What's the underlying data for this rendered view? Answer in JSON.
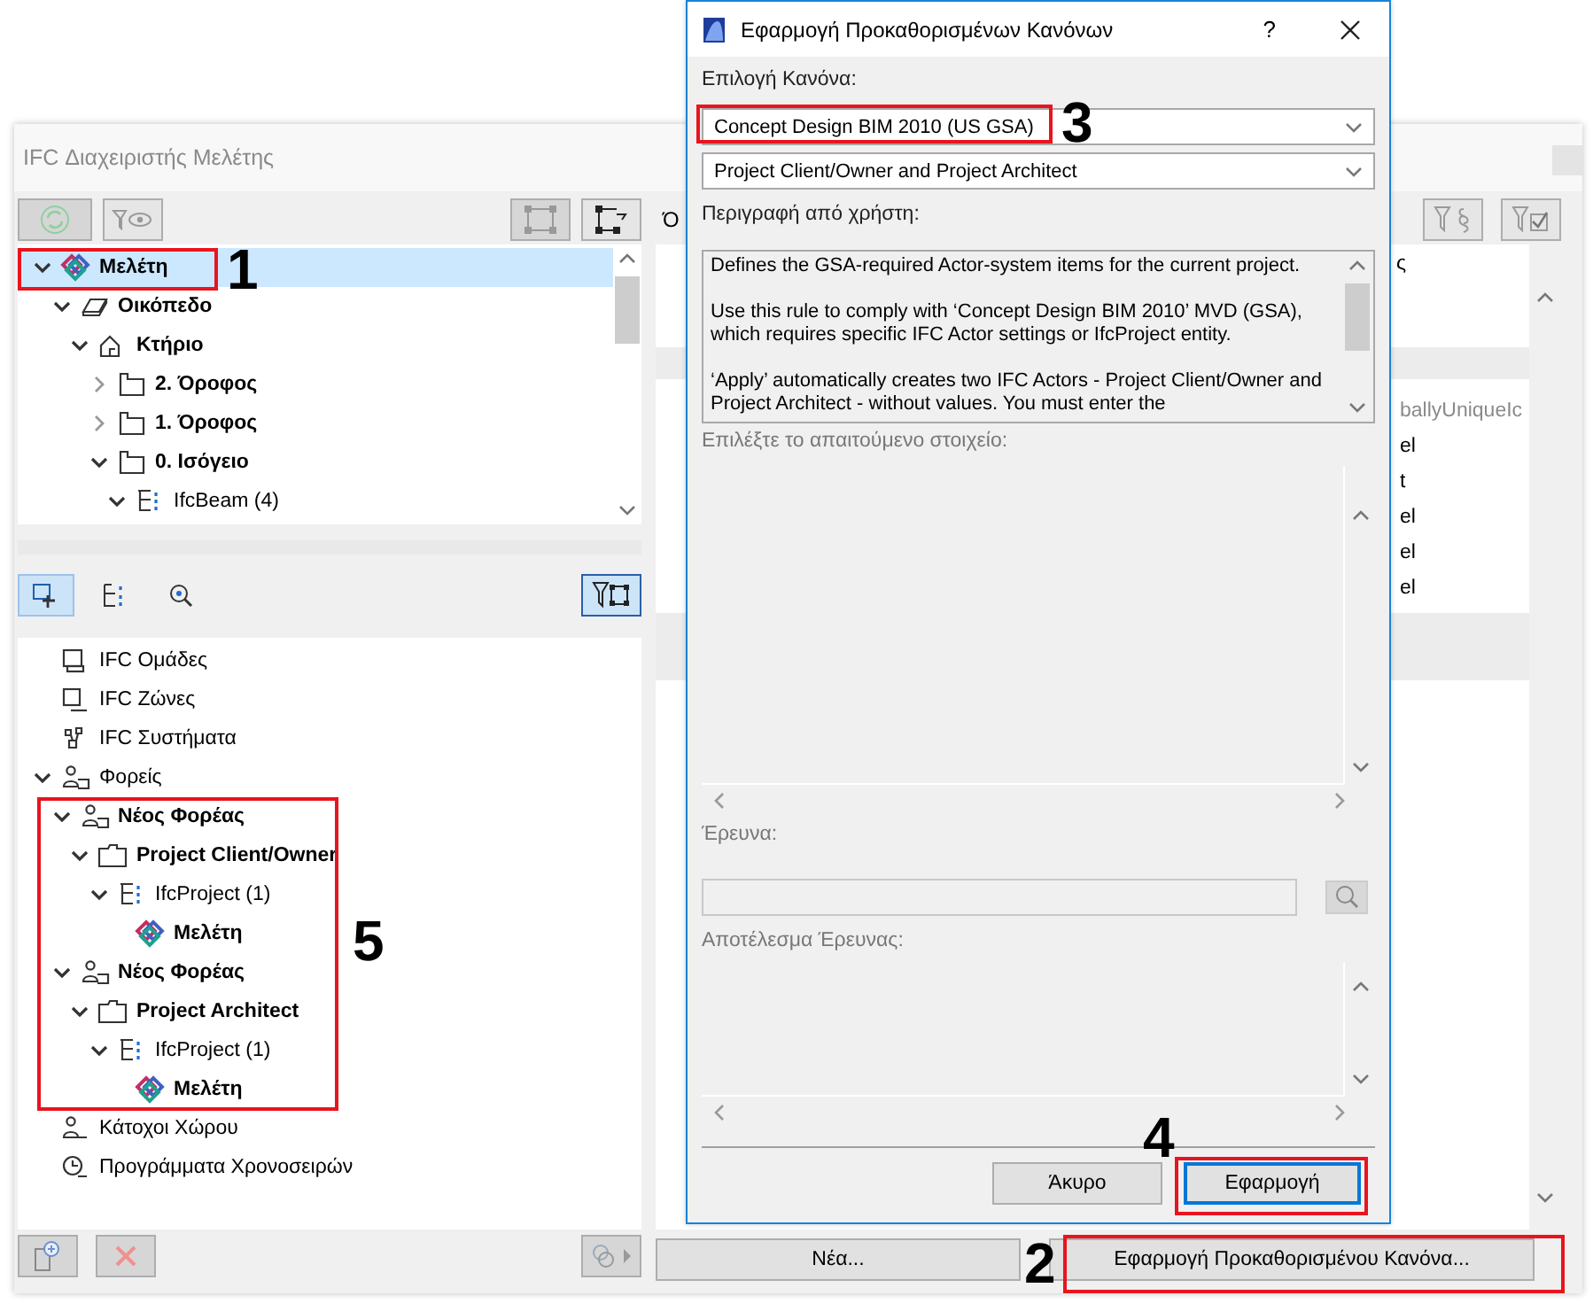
{
  "window": {
    "title": "IFC Διαχειριστής Μελέτης"
  },
  "project_tree": {
    "items": [
      {
        "label": "Μελέτη",
        "kind": "project",
        "bold": true,
        "selected": true,
        "expanded": true,
        "children": [
          {
            "label": "Οικόπεδο",
            "kind": "site",
            "bold": true,
            "selected": false,
            "expanded": true,
            "children": [
              {
                "label": "Κτήριο",
                "kind": "building",
                "bold": true,
                "selected": false,
                "expanded": true,
                "children": [
                  {
                    "label": "2. Όροφος",
                    "kind": "storey",
                    "bold": true,
                    "selected": false,
                    "expanded": false
                  },
                  {
                    "label": "1. Όροφος",
                    "kind": "storey",
                    "bold": true,
                    "selected": false,
                    "expanded": false
                  },
                  {
                    "label": "0. Ισόγειο",
                    "kind": "storey",
                    "bold": true,
                    "selected": false,
                    "expanded": true,
                    "children": [
                      {
                        "label": "IfcBeam (4)",
                        "kind": "type",
                        "bold": false,
                        "selected": false,
                        "expanded": true
                      }
                    ]
                  }
                ]
              }
            ]
          }
        ]
      }
    ]
  },
  "view_tabs": [
    {
      "selected": true
    },
    {
      "selected": false
    },
    {
      "selected": false
    }
  ],
  "groups_tree": {
    "items": [
      {
        "label": "IFC Ομάδες",
        "kind": "group",
        "bold": false,
        "selected": false
      },
      {
        "label": "IFC Ζώνες",
        "kind": "zone",
        "bold": false,
        "selected": false
      },
      {
        "label": "IFC Συστήματα",
        "kind": "system",
        "bold": false,
        "selected": false
      },
      {
        "label": "Φορείς",
        "kind": "actor",
        "bold": false,
        "selected": false,
        "expanded": true,
        "children": [
          {
            "label": "Νέος Φορέας",
            "kind": "actor",
            "bold": true,
            "selected": false,
            "expanded": true,
            "children": [
              {
                "label": "Project Client/Owner",
                "kind": "folder",
                "bold": true,
                "selected": false,
                "expanded": true,
                "children": [
                  {
                    "label": "IfcProject (1)",
                    "kind": "type",
                    "bold": false,
                    "selected": false,
                    "expanded": true,
                    "children": [
                      {
                        "label": "Μελέτη",
                        "kind": "project",
                        "bold": true,
                        "selected": false
                      }
                    ]
                  }
                ]
              }
            ]
          },
          {
            "label": "Νέος Φορέας",
            "kind": "actor",
            "bold": true,
            "selected": false,
            "expanded": true,
            "children": [
              {
                "label": "Project Architect",
                "kind": "folder",
                "bold": true,
                "selected": false,
                "expanded": true,
                "children": [
                  {
                    "label": "IfcProject (1)",
                    "kind": "type",
                    "bold": false,
                    "selected": false,
                    "expanded": true,
                    "children": [
                      {
                        "label": "Μελέτη",
                        "kind": "project",
                        "bold": true,
                        "selected": false
                      }
                    ]
                  }
                ]
              }
            ]
          }
        ]
      },
      {
        "label": "Κάτοχοι Χώρου",
        "kind": "occupant",
        "bold": false,
        "selected": false
      },
      {
        "label": "Προγράμματα Χρονοσειρών",
        "kind": "schedule",
        "bold": false,
        "selected": false
      }
    ]
  },
  "right_panel": {
    "tab_fragment": "Ό",
    "header_fragment": "ς",
    "rows": [
      "ballyUniqueIc",
      "el",
      "t",
      "el",
      "el",
      "el"
    ]
  },
  "buttons": [
    "Νέα...",
    "Εφαρμογή Προκαθορισμένου Κανόνα..."
  ],
  "dialog": {
    "title": "Εφαρμογή Προκαθορισμένων Κανόνων",
    "help": "?",
    "rule_label": "Επιλογή Κανόνα:",
    "rule": "Concept Design BIM 2010 (US GSA)",
    "variant": "Project Client/Owner and Project Architect",
    "description_label": "Περιγραφή από χρήστη:",
    "description": [
      "Defines the GSA-required Actor-system items for the current project.",
      "Use this rule to comply with ‘Concept Design BIM 2010’ MVD (GSA), which requires specific IFC Actor settings or IfcProject entity.",
      "‘Apply’ automatically creates two IFC Actors - Project Client/Owner and Project Architect - without values. You must enter the"
    ],
    "element_label": "Επιλέξτε το απαιτούμενο στοιχείο:",
    "search_label": "Έρευνα:",
    "result_label": "Αποτέλεσμα Έρευνας:",
    "buttons": [
      {
        "label": "Άκυρο",
        "default": false
      },
      {
        "label": "Εφαρμογή",
        "default": true
      }
    ]
  },
  "annotations": [
    {
      "number": "1"
    },
    {
      "number": "2"
    },
    {
      "number": "3"
    },
    {
      "number": "4"
    },
    {
      "number": "5"
    }
  ]
}
